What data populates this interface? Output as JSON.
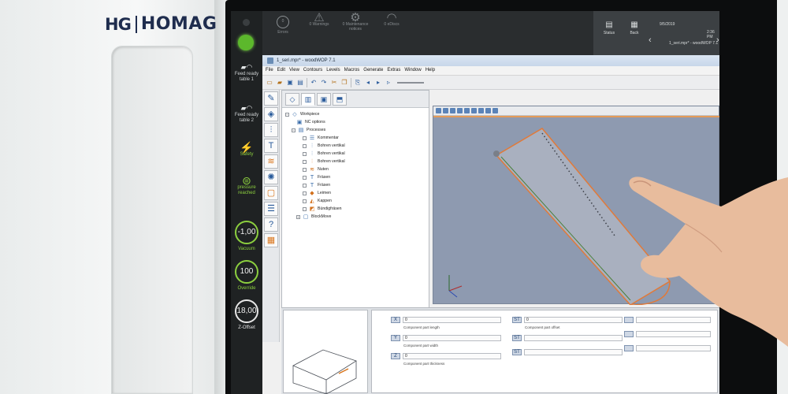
{
  "brand": {
    "mark": "HG",
    "name": "HOMAG"
  },
  "control_strip": {
    "items": [
      {
        "label": "Feed ready table 1",
        "icon": "feed-icon"
      },
      {
        "label": "Feed ready table 2",
        "icon": "feed-icon"
      },
      {
        "label": "Safety",
        "icon": "safety-icon"
      },
      {
        "label": "pressure reached",
        "icon": "pressure-icon"
      }
    ],
    "gauges": [
      {
        "value": "-1,00",
        "label": "Vacuum"
      },
      {
        "value": "100",
        "label": "Override"
      },
      {
        "value": "18,00",
        "label": "Z-Offset"
      }
    ]
  },
  "topbar": {
    "buttons": [
      {
        "label": "Errors",
        "value": "0"
      },
      {
        "label": "Warnings",
        "value": "0"
      },
      {
        "label": "Maintenance notices",
        "value": "0"
      },
      {
        "label": "eDiscs",
        "value": "0"
      }
    ],
    "right": {
      "btn1": "Status",
      "btn2": "Back",
      "date": "9/5/2019",
      "time": "2:36 PM",
      "file": "1_seri.mpr* - woodWOP 7.1"
    }
  },
  "window": {
    "title": "1_seri.mpr* - woodWOP 7.1",
    "menu": [
      "File",
      "Edit",
      "View",
      "Contours",
      "Levels",
      "Macros",
      "Generate",
      "Extras",
      "Window",
      "Help"
    ]
  },
  "tree": {
    "root": "Workpiece",
    "nc": "NC options",
    "processes": "Processes",
    "items": [
      "Kommentar",
      "Bohren vertikal",
      "Bohren vertikal",
      "Bohren vertikal",
      "Nuten",
      "Fräsen",
      "Fräsen",
      "Leimen",
      "Kappen",
      "Bündigfräsen",
      "BlockMove"
    ]
  },
  "params": {
    "col1": [
      "X",
      "Y",
      "Z"
    ],
    "col1_labels": [
      "Component part length",
      "Component part width",
      "Component part thickness"
    ],
    "col2": [
      "ST",
      "ST",
      "ST"
    ],
    "col2_labels": [
      "Component part offset",
      "",
      ""
    ],
    "field_value": "0"
  },
  "colors": {
    "accent_green": "#8ccf3f",
    "status_green": "#5cb82c",
    "view_bg": "#8e9ab0",
    "workpiece_edge": "#e07a3a"
  }
}
